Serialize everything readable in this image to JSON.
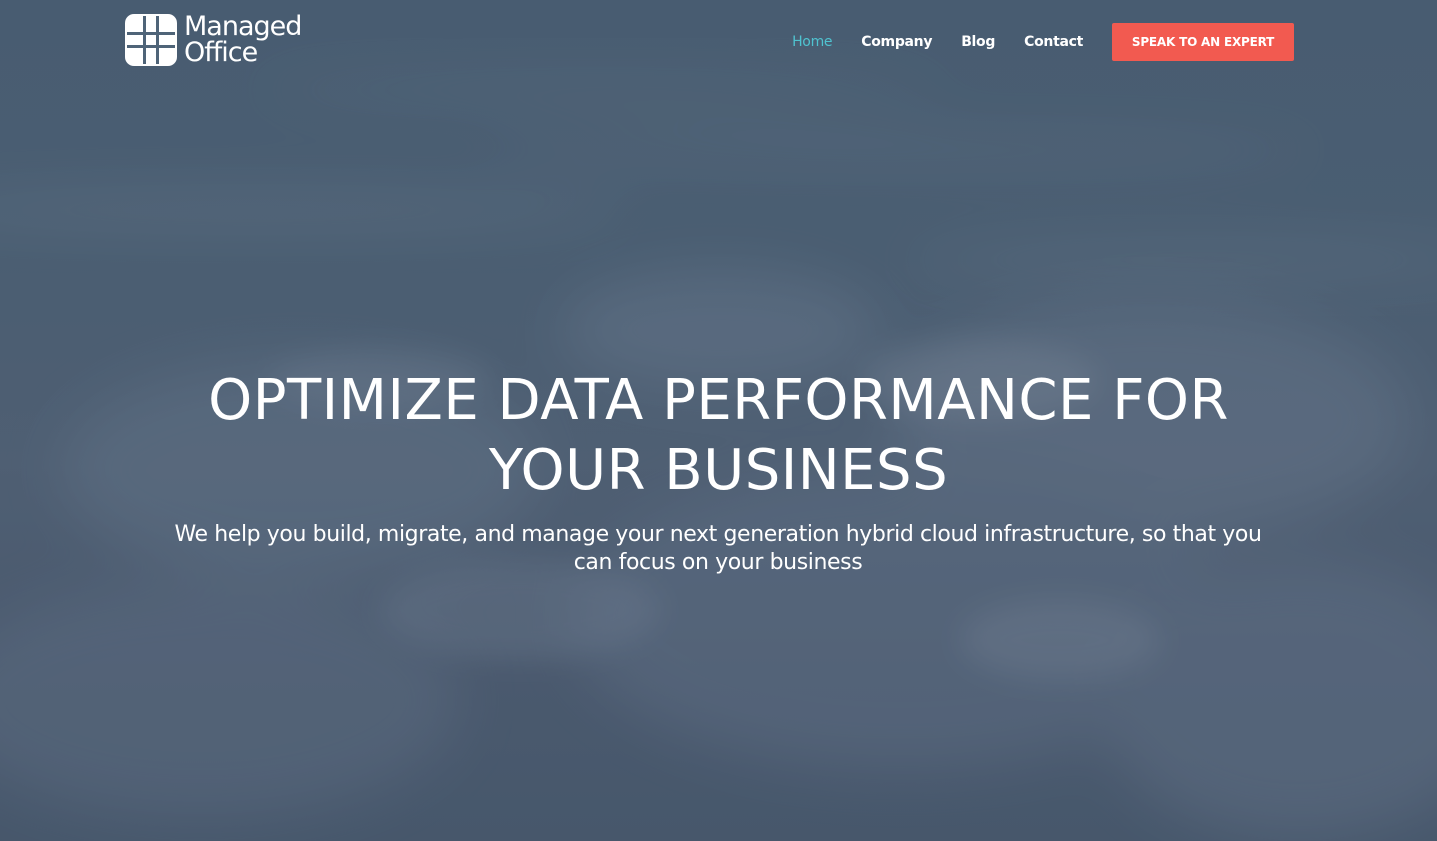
{
  "brand": {
    "line1": "Managed",
    "line2": "Office",
    "icon": "logo-cross-icon"
  },
  "nav": {
    "items": [
      {
        "label": "Home",
        "active": true
      },
      {
        "label": "Company",
        "active": false
      },
      {
        "label": "Blog",
        "active": false
      },
      {
        "label": "Contact",
        "active": false
      }
    ],
    "cta_label": "SPEAK TO AN EXPERT"
  },
  "hero": {
    "headline_line1": "OPTIMIZE DATA PERFORMANCE FOR",
    "headline_line2": "YOUR BUSINESS",
    "subline_line1": "We help you build, migrate, and manage your next generation hybrid cloud infrastructure, so that you",
    "subline_line2": "can focus on your business"
  },
  "colors": {
    "accent_active": "#4fc3d0",
    "cta_background": "#f25a50",
    "background": "#4f6478"
  }
}
